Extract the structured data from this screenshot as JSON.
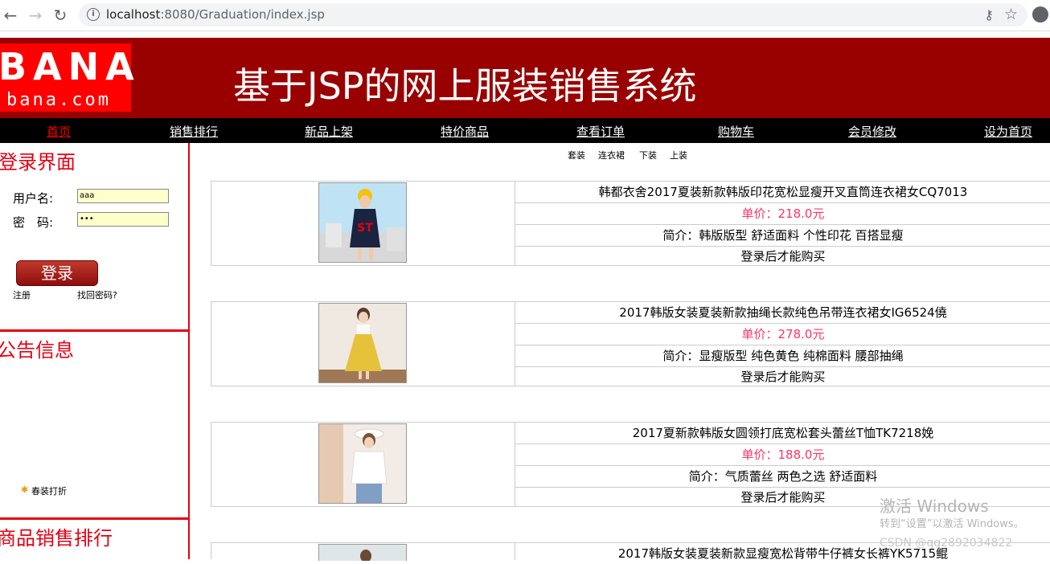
{
  "browser": {
    "url_host": "localhost",
    "url_rest": ":8080/Graduation/index.jsp"
  },
  "header": {
    "logo_big": "BANA",
    "logo_small": "bana.com",
    "title": "基于JSP的网上服装销售系统"
  },
  "nav": {
    "items": [
      "首页",
      "销售排行",
      "新品上架",
      "特价商品",
      "查看订单",
      "购物车",
      "会员修改",
      "设为首页"
    ],
    "active_color": "#ff0000"
  },
  "login": {
    "title": "登录界面",
    "username_label": "用户名:",
    "username_value": "aaa",
    "password_label": "密　码:",
    "password_value": "•••",
    "login_button": "登录",
    "register_link": "注册",
    "forgot_link": "找回密码?"
  },
  "notice": {
    "title": "公告信息",
    "items": [
      "春装打折"
    ]
  },
  "ranking": {
    "title": "商品销售排行"
  },
  "categories": [
    "套装",
    "连衣裙",
    "下装",
    "上装"
  ],
  "products": [
    {
      "name": "韩都衣舍2017夏装新款韩版印花宽松显瘦开叉直筒连衣裙女CQ7013",
      "price": "单价：218.0元",
      "desc": "简介：韩版版型 舒适面料 个性印花 百搭显瘦",
      "action": "登录后才能购买"
    },
    {
      "name": "2017韩版女装夏装新款抽绳长款纯色吊带连衣裙女IG6524僥",
      "price": "单价：278.0元",
      "desc": "简介：显瘦版型 纯色黄色 纯棉面料 腰部抽绳",
      "action": "登录后才能购买"
    },
    {
      "name": "2017夏新款韩版女圆领打底宽松套头蕾丝T恤TK7218娩",
      "price": "单价：188.0元",
      "desc": "简介：气质蕾丝 两色之选 舒适面料",
      "action": "登录后才能购买"
    },
    {
      "name": "2017韩版女装夏装新款显瘦宽松背带牛仔裤女长裤YK5715鲲"
    }
  ],
  "watermark": {
    "line1": "激活 Windows",
    "line2": "转到“设置”以激活 Windows。",
    "line3": "CSDN @qq2892034822"
  },
  "colors": {
    "banner": "#990000",
    "logo_bg": "#ff0000",
    "accent_red": "#e60012",
    "price": "#ff3366"
  }
}
